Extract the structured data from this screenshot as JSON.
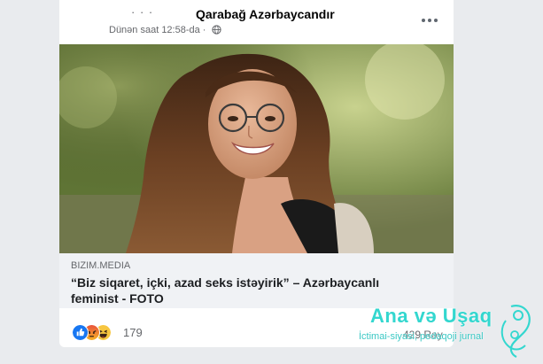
{
  "post": {
    "author": "Qarabağ Azərbaycandır",
    "timestamp": "Dünən saat 12:58-da ·",
    "menu_icon": "more-horizontal-icon",
    "privacy_icon": "globe-icon"
  },
  "link_preview": {
    "domain": "BIZIM.MEDIA",
    "title": "“Biz siqaret, içki, azad seks istəyirik” – Azərbaycanlı feminist - FOTO",
    "info_icon": "info-icon"
  },
  "footer": {
    "reaction_icons": [
      "like-icon",
      "angry-icon",
      "haha-icon"
    ],
    "reaction_count": "179",
    "comment_count": "429 Rəy"
  },
  "watermark": {
    "title": "Ana və Uşaq",
    "subtitle": "İctimai-siyasi, pedaqoji jurnal"
  },
  "colors": {
    "background": "#e9ebee",
    "card": "#ffffff",
    "link_area": "#f0f2f5",
    "like_blue": "#1877f2",
    "watermark": "#33d7cf"
  }
}
